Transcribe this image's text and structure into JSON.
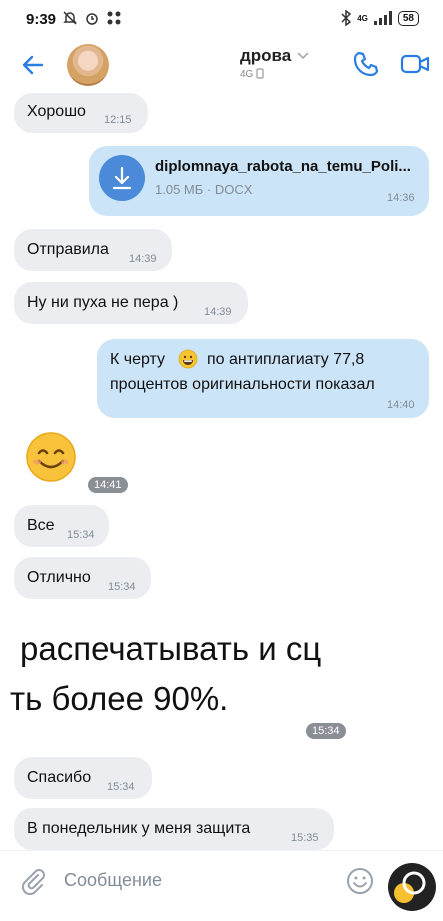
{
  "status_bar": {
    "time": "9:39",
    "network": "4G",
    "battery": "58"
  },
  "header": {
    "contact_name": "дрова",
    "status_text": "4G"
  },
  "messages": [
    {
      "kind": "in",
      "text": "Хорошо",
      "time": "12:15"
    },
    {
      "kind": "out_file",
      "file_name": "diplomnaya_rabota_na_temu_Poli...",
      "file_meta": "1.05 МБ · DOCX",
      "time": "14:36"
    },
    {
      "kind": "in",
      "text": "Отправила",
      "time": "14:39"
    },
    {
      "kind": "in",
      "text": "Ну ни пуха не пера )",
      "time": "14:39"
    },
    {
      "kind": "out",
      "line1": "К черту",
      "line1b": "по антиплагиату 77,8",
      "line2": "процентов оригинальности показал",
      "time": "14:40"
    },
    {
      "kind": "emoji",
      "time": "14:41"
    },
    {
      "kind": "in",
      "text": "Все",
      "time": "15:34"
    },
    {
      "kind": "in",
      "text": "Отлично",
      "time": "15:34"
    },
    {
      "kind": "photo",
      "line1": "распечатывать и сц",
      "line2": "ть более 90%.",
      "time": "15:34"
    },
    {
      "kind": "in",
      "text": "Спасибо",
      "time": "15:34"
    },
    {
      "kind": "in",
      "text": "В понедельник у меня защита",
      "time": "15:35"
    }
  ],
  "composer": {
    "placeholder": "Сообщение"
  }
}
